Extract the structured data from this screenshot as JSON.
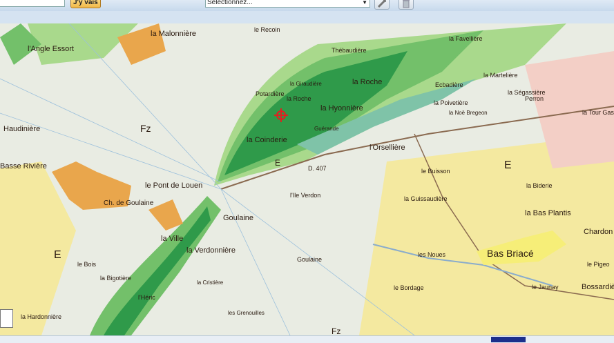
{
  "toolbar": {
    "search_placeholder": "",
    "go_label": "J'y vais",
    "select_value": "Sélectionnez...",
    "tools": [
      {
        "name": "measure-icon"
      },
      {
        "name": "trash-icon"
      }
    ]
  },
  "map": {
    "marker_icon": "target-crosshair-icon",
    "colors": {
      "alluvium": "#e9ece3",
      "green_dark": "#2f9a4a",
      "green_mid": "#73c06a",
      "green_light": "#a9d98c",
      "teal": "#7fc3a8",
      "yellow": "#f4e9a0",
      "pink": "#f3cfc6",
      "orange": "#e9a64c",
      "marker": "#e02020"
    },
    "labels": [
      "la Malonnière",
      "le Recoin",
      "l'Angle Essort",
      "la Favellière",
      "Thébaudière",
      "la Giraudière",
      "la Roche",
      "la Martelière",
      "Potardière",
      "la Roche",
      "Ecbadière",
      "la Ségassière",
      "Perron",
      "la Poivetière",
      "la Hyonnière",
      "la Tour Gast",
      "Haudinière",
      "Fz",
      "Guérande",
      "la Noë Bregeon",
      "la Coinderie",
      "l'Orsellière",
      "Basse Rivière",
      "E",
      "D. 407",
      "le Buisson",
      "E",
      "le Pont de Louen",
      "la Biderie",
      "Ch. de Goulaine",
      "l'Ile Verdon",
      "la Guissaudière",
      "la Bas Plantis",
      "Chardon",
      "la Ville",
      "Goulaine",
      "la Verdonnière",
      "E",
      "les Noues",
      "Bas Briacé",
      "le Pigeo",
      "le Bois",
      "la Bigotière",
      "Goulaine",
      "le Jaunay",
      "Bossardière",
      "la Cristière",
      "le Bordage",
      "l'Héric",
      "les Grenouilles",
      "la Hardonnière",
      "Fz"
    ]
  }
}
